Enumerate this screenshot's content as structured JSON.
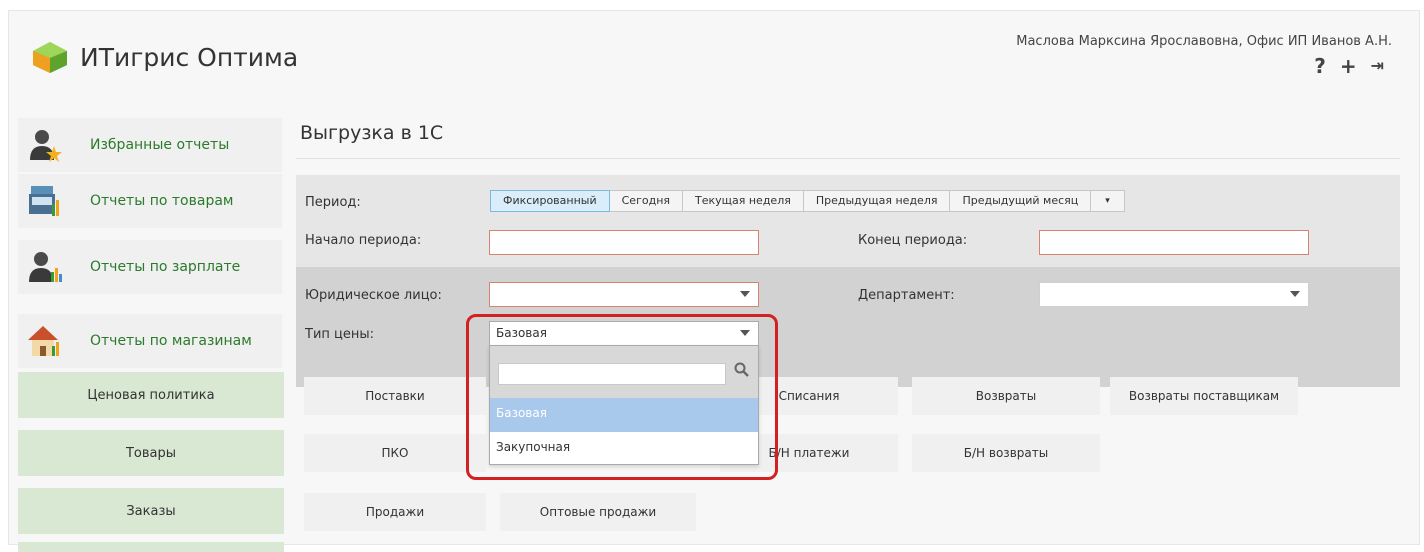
{
  "app": {
    "title": "ИТигрис Оптима"
  },
  "header": {
    "user_info": "Маслова Марксина Ярославовна, Офис ИП Иванов А.Н.",
    "icons": [
      "help-icon",
      "add-icon",
      "logout-icon"
    ],
    "help_glyph": "?",
    "add_glyph": "+",
    "logout_glyph": "⇥"
  },
  "sidebar": {
    "big_items": [
      {
        "label": "Избранные отчеты",
        "icon": "user-star-icon"
      },
      {
        "label": "Отчеты по товарам",
        "icon": "register-chart-icon"
      },
      {
        "label": "Отчеты по зарплате",
        "icon": "user-chart-icon"
      },
      {
        "label": "Отчеты по магазинам",
        "icon": "house-chart-icon"
      }
    ],
    "green_items": [
      "Ценовая политика",
      "Товары",
      "Заказы"
    ]
  },
  "main": {
    "page_title": "Выгрузка в 1С",
    "filters": {
      "period_label": "Период:",
      "period_options": [
        "Фиксированный",
        "Сегодня",
        "Текущая неделя",
        "Предыдущая неделя",
        "Предыдущий месяц"
      ],
      "period_more": "▾",
      "start_label": "Начало периода:",
      "start_value": "",
      "end_label": "Конец периода:",
      "end_value": "",
      "legal_label": "Юридическое лицо:",
      "legal_value": "",
      "department_label": "Департамент:",
      "department_value": "",
      "price_type_label": "Тип цены:",
      "price_type_value": "Базовая"
    },
    "dropdown": {
      "search_value": "",
      "options": [
        "Базовая",
        "Закупочная"
      ],
      "highlighted": "Базовая"
    },
    "buttons": {
      "row1": [
        "Поставки",
        "Списания",
        "Возвраты",
        "Возвраты поставщикам"
      ],
      "row2": [
        "ПКО",
        "Б/Н платежи",
        "Б/Н возвраты"
      ],
      "row3": [
        "Продажи",
        "Оптовые продажи"
      ]
    }
  },
  "colors": {
    "accent_green": "#2c7a2c",
    "sidebar_green": "#d8e8d2",
    "highlight_red": "#d32020",
    "dropdown_highlight": "#a8c8ec"
  }
}
